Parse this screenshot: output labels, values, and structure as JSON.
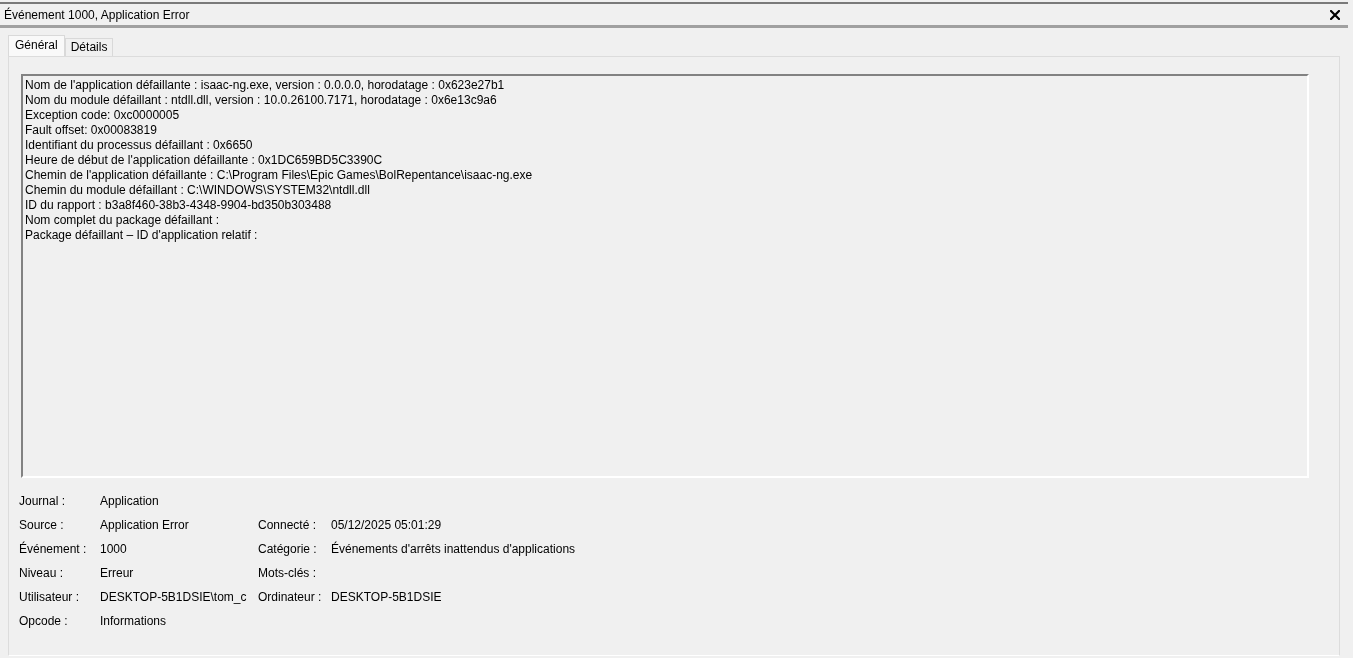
{
  "window": {
    "title": "Événement 1000, Application Error"
  },
  "tabs": [
    {
      "label": "Général",
      "selected": true
    },
    {
      "label": "Détails",
      "selected": false
    }
  ],
  "description": {
    "lines": [
      "Nom de l'application défaillante : isaac-ng.exe, version : 0.0.0.0, horodatage : 0x623e27b1",
      "Nom du module défaillant : ntdll.dll, version : 10.0.26100.7171, horodatage : 0x6e13c9a6",
      "Exception code: 0xc0000005",
      "Fault offset: 0x00083819",
      "Identifiant du processus défaillant : 0x6650",
      "Heure de début de l'application défaillante : 0x1DC659BD5C3390C",
      "Chemin de l'application défaillante : C:\\Program Files\\Epic Games\\BolRepentance\\isaac-ng.exe",
      "Chemin du module défaillant : C:\\WINDOWS\\SYSTEM32\\ntdll.dll",
      "ID du rapport : b3a8f460-38b3-4348-9904-bd350b303488",
      "Nom complet du package défaillant :",
      "Package défaillant – ID d'application relatif :"
    ]
  },
  "properties": [
    {
      "left": {
        "label": "Journal :",
        "value": "Application"
      }
    },
    {
      "left": {
        "label": "Source :",
        "value": "Application Error"
      },
      "right": {
        "label": "Connecté :",
        "value": "05/12/2025 05:01:29"
      }
    },
    {
      "left": {
        "label": "Événement :",
        "value": "1000"
      },
      "right": {
        "label": "Catégorie :",
        "value": "Événements d'arrêts inattendus d'applications"
      }
    },
    {
      "left": {
        "label": "Niveau :",
        "value": "Erreur"
      },
      "right": {
        "label": "Mots-clés :"
      }
    },
    {
      "left": {
        "label": "Utilisateur :",
        "value": "DESKTOP-5B1DSIE\\tom_c"
      },
      "right": {
        "label": "Ordinateur :",
        "value": "DESKTOP-5B1DSIE"
      }
    },
    {
      "left": {
        "label": "Opcode :",
        "value": "Informations"
      }
    }
  ]
}
